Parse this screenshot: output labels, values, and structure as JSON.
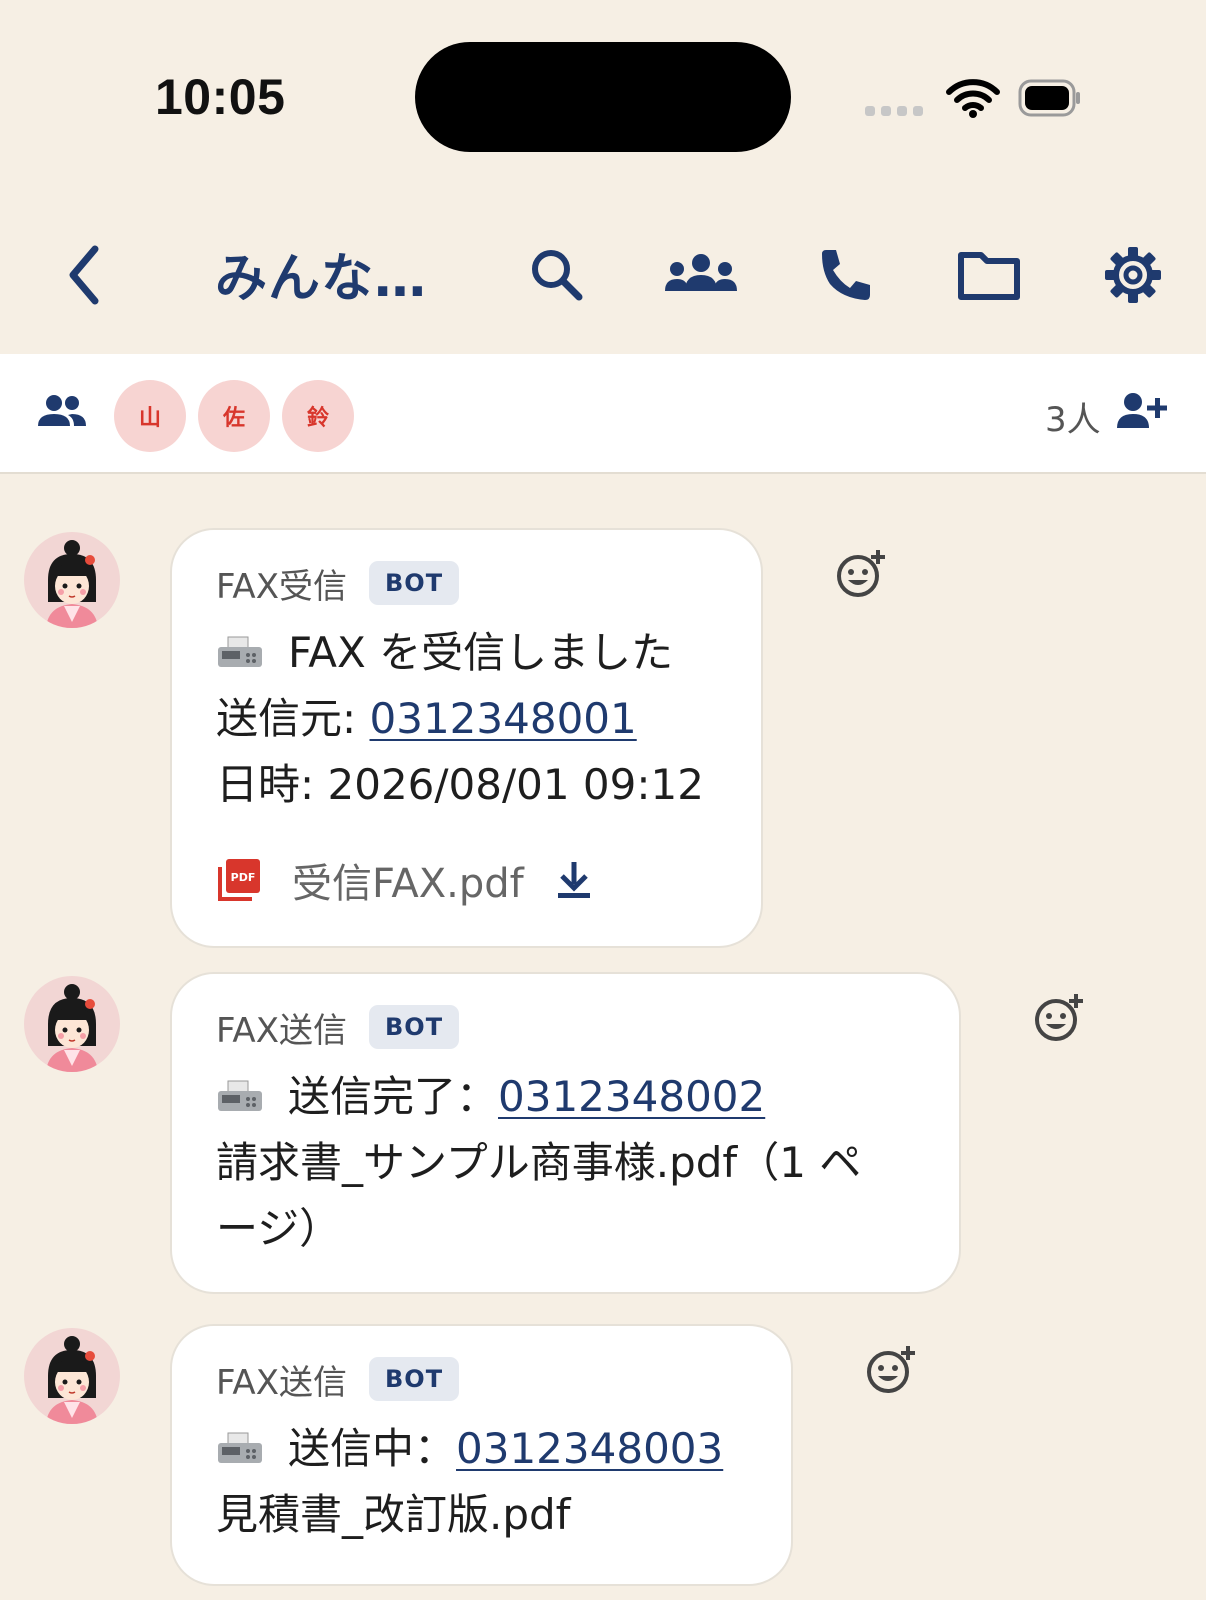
{
  "status_bar": {
    "time": "10:05"
  },
  "header": {
    "title": "みんな…",
    "icons": [
      "back-icon",
      "search-icon",
      "group-icon",
      "phone-icon",
      "folder-icon",
      "gear-icon"
    ]
  },
  "members": {
    "avatars": [
      "山",
      "佐",
      "鈴"
    ],
    "count": "3人",
    "colors": {
      "avatar_bg": "#f7d4d2",
      "avatar_text": "#d8362c"
    }
  },
  "messages": [
    {
      "sender": "FAX受信",
      "badge": "BOT",
      "line1": "FAX を受信しました",
      "line2_label": "送信元: ",
      "line2_phone": "0312348001",
      "line3": "日時: 2026/08/01 09:12",
      "attachment": "受信FAX.pdf"
    },
    {
      "sender": "FAX送信",
      "badge": "BOT",
      "line1_label": "送信完了：",
      "line1_phone": "0312348002",
      "line2": "請求書_サンプル商事様.pdf（1 ペ",
      "line3": "ージ）"
    },
    {
      "sender": "FAX送信",
      "badge": "BOT",
      "line1_label": "送信中：",
      "line1_phone": "0312348003",
      "line2": "見積書_改訂版.pdf"
    }
  ],
  "colors": {
    "accent": "#1f3a6e",
    "background": "#f6efe4",
    "pdf_red": "#d8362c"
  }
}
